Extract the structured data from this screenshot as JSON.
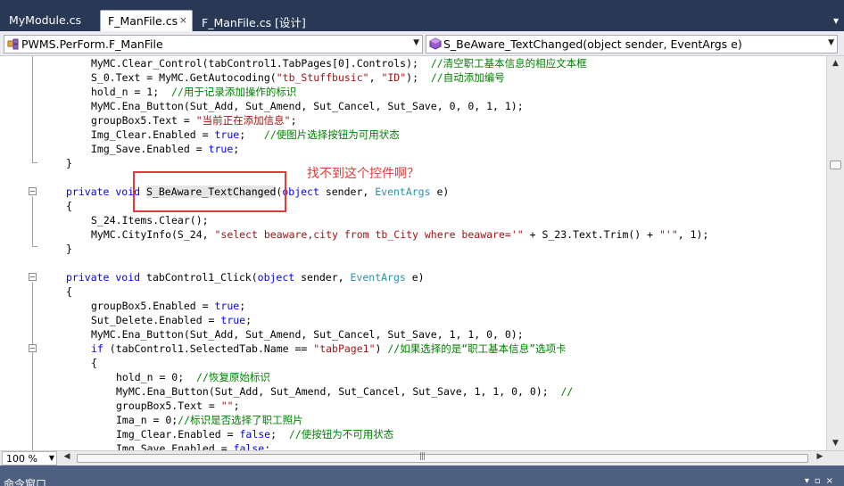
{
  "tabs": [
    {
      "label": "MyModule.cs",
      "active": false
    },
    {
      "label": "F_ManFile.cs",
      "active": true
    },
    {
      "label": "F_ManFile.cs [设计]",
      "active": false
    }
  ],
  "tab_close_glyph": "×",
  "nav": {
    "class_combo": "PWMS.PerForm.F_ManFile",
    "member_combo": "S_BeAware_TextChanged(object sender, EventArgs e)"
  },
  "annotation": {
    "note": "找不到这个控件啊？",
    "color": "#e23a3a"
  },
  "bottom": {
    "zoom": "100 %"
  },
  "command_window": {
    "label": "命令窗口"
  },
  "colors": {
    "keyword": "#0000ff",
    "comment": "#008000",
    "string": "#a31515",
    "type": "#2b91af",
    "chrome_dark": "#293955"
  },
  "code_lines": [
    {
      "indent": 2,
      "parts": [
        [
          "t",
          "MyMC.Clear_Control(tabControl1.TabPages[0].Controls);  "
        ],
        [
          "c",
          "//清空职工基本信息的相应文本框"
        ]
      ]
    },
    {
      "indent": 2,
      "parts": [
        [
          "t",
          "S_0.Text = MyMC.GetAutocoding("
        ],
        [
          "s",
          "\"tb_Stuffbusic\""
        ],
        [
          "t",
          ", "
        ],
        [
          "s",
          "\"ID\""
        ],
        [
          "t",
          ");  "
        ],
        [
          "c",
          "//自动添加编号"
        ]
      ]
    },
    {
      "indent": 2,
      "parts": [
        [
          "t",
          "hold_n = 1;  "
        ],
        [
          "c",
          "//用于记录添加操作的标识"
        ]
      ]
    },
    {
      "indent": 2,
      "parts": [
        [
          "t",
          "MyMC.Ena_Button(Sut_Add, Sut_Amend, Sut_Cancel, Sut_Save, 0, 0, 1, 1);"
        ]
      ]
    },
    {
      "indent": 2,
      "parts": [
        [
          "t",
          "groupBox5.Text = "
        ],
        [
          "s",
          "\"当前正在添加信息\""
        ],
        [
          "t",
          ";"
        ]
      ]
    },
    {
      "indent": 2,
      "parts": [
        [
          "t",
          "Img_Clear.Enabled = "
        ],
        [
          "k",
          "true"
        ],
        [
          "t",
          ";   "
        ],
        [
          "c",
          "//使图片选择按钮为可用状态"
        ]
      ]
    },
    {
      "indent": 2,
      "parts": [
        [
          "t",
          "Img_Save.Enabled = "
        ],
        [
          "k",
          "true"
        ],
        [
          "t",
          ";"
        ]
      ]
    },
    {
      "indent": 1,
      "parts": [
        [
          "t",
          "}"
        ]
      ]
    },
    {
      "indent": 1,
      "parts": []
    },
    {
      "indent": 1,
      "parts": [
        [
          "k",
          "private void "
        ],
        [
          "h",
          "S_BeAware_TextChanged"
        ],
        [
          "t",
          "("
        ],
        [
          "k",
          "object"
        ],
        [
          "t",
          " sender, "
        ],
        [
          "y",
          "EventArgs"
        ],
        [
          "t",
          " e)"
        ]
      ]
    },
    {
      "indent": 1,
      "parts": [
        [
          "t",
          "{"
        ]
      ]
    },
    {
      "indent": 2,
      "parts": [
        [
          "t",
          "S_24.Items.Clear();"
        ]
      ]
    },
    {
      "indent": 2,
      "parts": [
        [
          "t",
          "MyMC.CityInfo(S_24, "
        ],
        [
          "s",
          "\"select beaware,city from tb_City where beaware='\""
        ],
        [
          "t",
          " + S_23.Text.Trim() + "
        ],
        [
          "s",
          "\"'\""
        ],
        [
          "t",
          ", 1);"
        ]
      ]
    },
    {
      "indent": 1,
      "parts": [
        [
          "t",
          "}"
        ]
      ]
    },
    {
      "indent": 1,
      "parts": []
    },
    {
      "indent": 1,
      "parts": [
        [
          "k",
          "private void "
        ],
        [
          "t",
          "tabControl1_Click("
        ],
        [
          "k",
          "object"
        ],
        [
          "t",
          " sender, "
        ],
        [
          "y",
          "EventArgs"
        ],
        [
          "t",
          " e)"
        ]
      ]
    },
    {
      "indent": 1,
      "parts": [
        [
          "t",
          "{"
        ]
      ]
    },
    {
      "indent": 2,
      "parts": [
        [
          "t",
          "groupBox5.Enabled = "
        ],
        [
          "k",
          "true"
        ],
        [
          "t",
          ";"
        ]
      ]
    },
    {
      "indent": 2,
      "parts": [
        [
          "t",
          "Sut_Delete.Enabled = "
        ],
        [
          "k",
          "true"
        ],
        [
          "t",
          ";"
        ]
      ]
    },
    {
      "indent": 2,
      "parts": [
        [
          "t",
          "MyMC.Ena_Button(Sut_Add, Sut_Amend, Sut_Cancel, Sut_Save, 1, 1, 0, 0);"
        ]
      ]
    },
    {
      "indent": 2,
      "parts": [
        [
          "k",
          "if"
        ],
        [
          "t",
          " (tabControl1.SelectedTab.Name == "
        ],
        [
          "s",
          "\"tabPage1\""
        ],
        [
          "t",
          ") "
        ],
        [
          "c",
          "//如果选择的是“职工基本信息”选项卡"
        ]
      ]
    },
    {
      "indent": 2,
      "parts": [
        [
          "t",
          "{"
        ]
      ]
    },
    {
      "indent": 3,
      "parts": [
        [
          "t",
          "hold_n = 0;  "
        ],
        [
          "c",
          "//恢复原始标识"
        ]
      ]
    },
    {
      "indent": 3,
      "parts": [
        [
          "t",
          "MyMC.Ena_Button(Sut_Add, Sut_Amend, Sut_Cancel, Sut_Save, 1, 1, 0, 0);  "
        ],
        [
          "c",
          "//"
        ]
      ]
    },
    {
      "indent": 3,
      "parts": [
        [
          "t",
          "groupBox5.Text = "
        ],
        [
          "s",
          "\"\""
        ],
        [
          "t",
          ";"
        ]
      ]
    },
    {
      "indent": 3,
      "parts": [
        [
          "t",
          "Ima_n = 0;"
        ],
        [
          "c",
          "//标识是否选择了职工照片"
        ]
      ]
    },
    {
      "indent": 3,
      "parts": [
        [
          "t",
          "Img_Clear.Enabled = "
        ],
        [
          "k",
          "false"
        ],
        [
          "t",
          ";  "
        ],
        [
          "c",
          "//使按钮为不可用状态"
        ]
      ]
    },
    {
      "indent": 3,
      "parts": [
        [
          "t",
          "Img_Save.Enabled = "
        ],
        [
          "k",
          "false"
        ],
        [
          "t",
          ";"
        ]
      ]
    }
  ]
}
